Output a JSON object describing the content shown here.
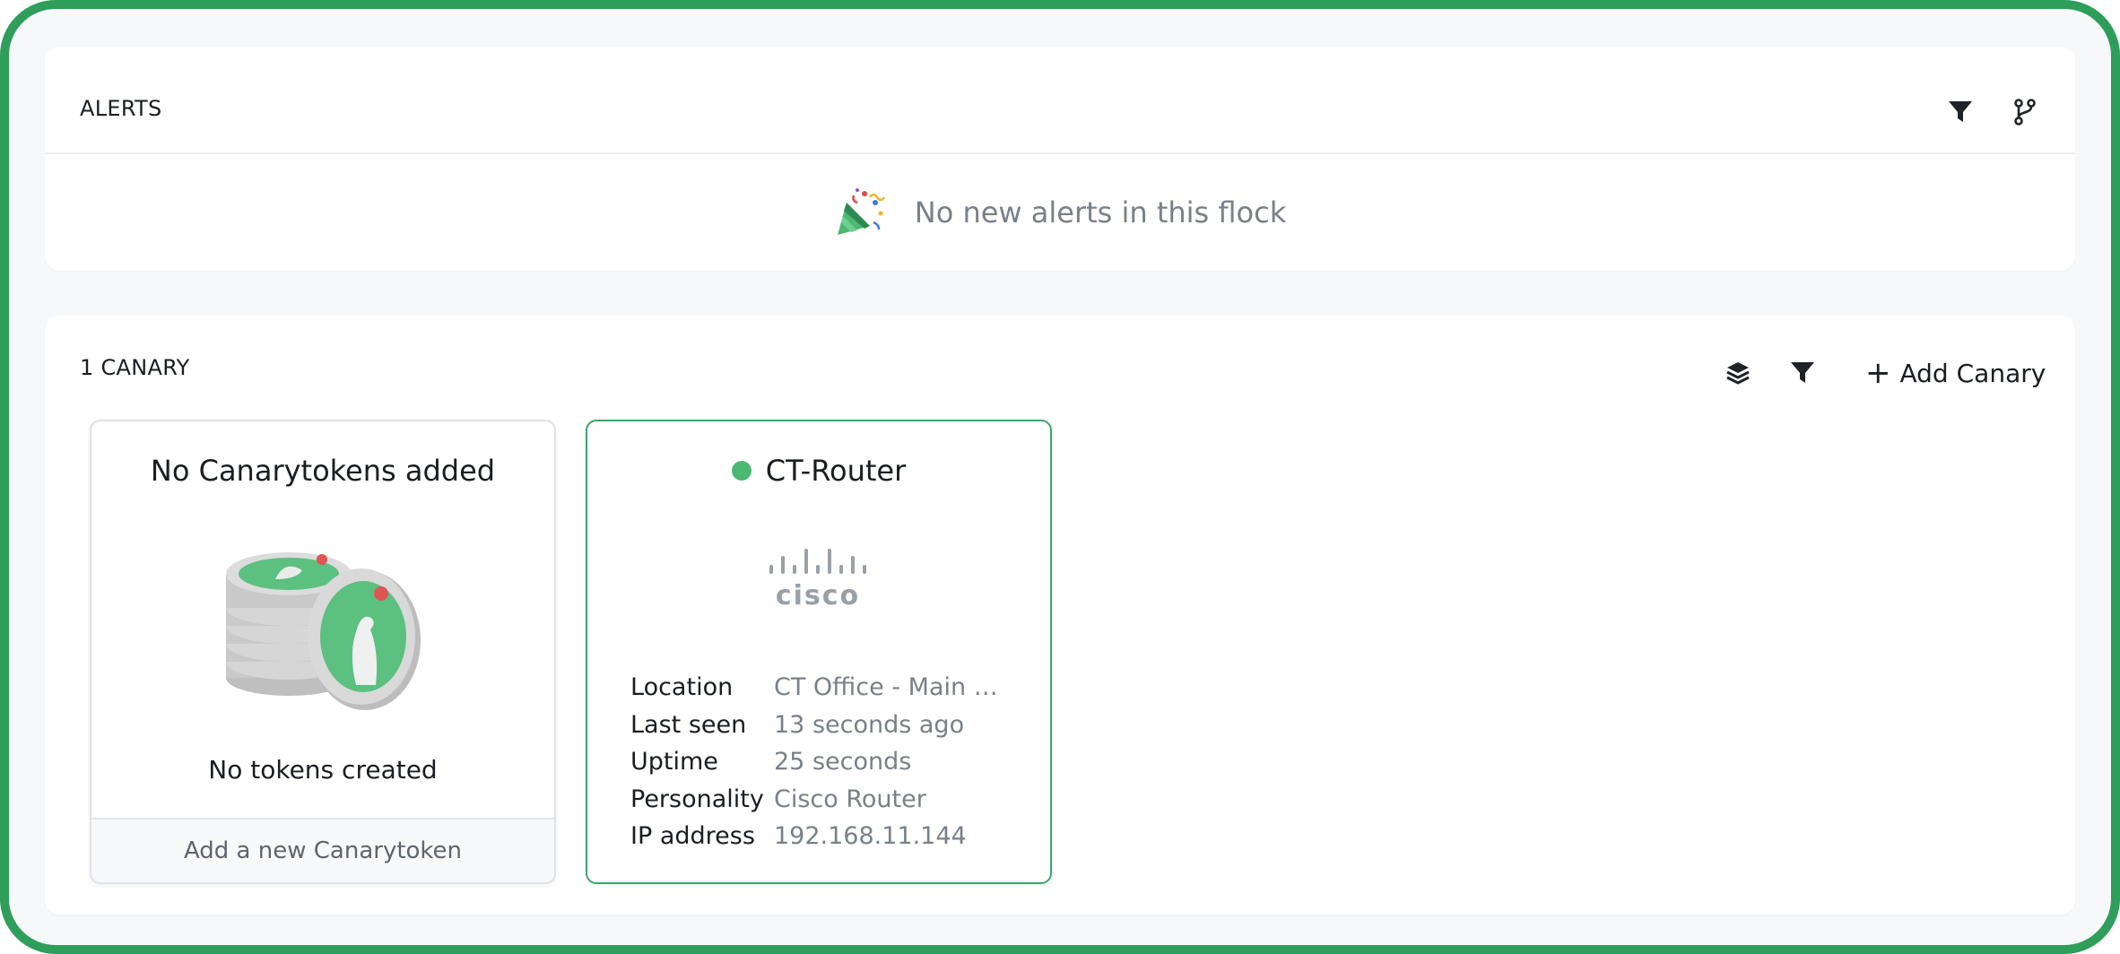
{
  "alerts": {
    "title": "ALERTS",
    "empty_message": "No new alerts in this flock",
    "icons": [
      "filter-icon",
      "fork-icon",
      "party-popper-icon"
    ]
  },
  "canaries": {
    "title": "1 CANARY",
    "add_label": "Add Canary",
    "icons": [
      "layers-icon",
      "filter-icon",
      "plus-icon"
    ]
  },
  "tokens_card": {
    "title": "No Canarytokens added",
    "message": "No tokens created",
    "footer": "Add a new Canarytoken",
    "icon": "canary-coins-icon"
  },
  "router_card": {
    "name": "CT-Router",
    "status": "online",
    "logo": "cisco-logo",
    "details": [
      {
        "key": "Location",
        "value": "CT Office - Main R..."
      },
      {
        "key": "Last seen",
        "value": "13 seconds ago"
      },
      {
        "key": "Uptime",
        "value": "25 seconds"
      },
      {
        "key": "Personality",
        "value": "Cisco Router"
      },
      {
        "key": "IP address",
        "value": "192.168.11.144"
      }
    ]
  },
  "colors": {
    "accent": "#2e9e5a",
    "status_online": "#4cb872",
    "muted_text": "#7a8088"
  }
}
